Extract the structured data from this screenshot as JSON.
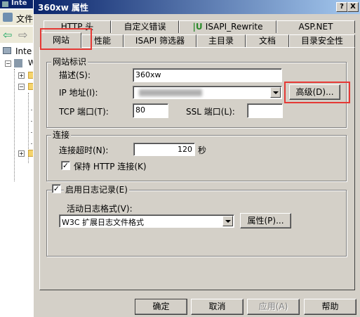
{
  "background": {
    "title": "Inte",
    "menu_file": "文件",
    "tree_root": "Inte",
    "tree_child": "W"
  },
  "dialog": {
    "title": "360xw 属性",
    "help_btn": "?",
    "close_btn": "X"
  },
  "tabs": {
    "row1": [
      "HTTP 头",
      "自定义错误",
      "ISAPI_Rewrite",
      "ASP.NET"
    ],
    "row2": [
      "网站",
      "性能",
      "ISAPI 筛选器",
      "主目录",
      "文档",
      "目录安全性"
    ],
    "active": "网站"
  },
  "site_id": {
    "group_title": "网站标识",
    "desc_label": "描述(S):",
    "desc_value": "360xw",
    "ip_label": "IP 地址(I):",
    "advanced_btn": "高级(D)...",
    "tcp_label": "TCP 端口(T):",
    "tcp_value": "80",
    "ssl_label": "SSL 端口(L):",
    "ssl_value": ""
  },
  "connections": {
    "group_title": "连接",
    "timeout_label": "连接超时(N):",
    "timeout_value": "120",
    "timeout_unit": "秒",
    "keepalive_label": "保持 HTTP 连接(K)",
    "keepalive_checked": true
  },
  "logging": {
    "enable_label": "启用日志记录(E)",
    "enable_checked": true,
    "format_label": "活动日志格式(V):",
    "format_value": "W3C 扩展日志文件格式",
    "props_btn": "属性(P)..."
  },
  "footer": {
    "ok": "确定",
    "cancel": "取消",
    "apply": "应用(A)",
    "help": "帮助"
  },
  "colors": {
    "highlight": "#e53935",
    "title_bar": "#0a246a",
    "face": "#d4d0c8"
  }
}
